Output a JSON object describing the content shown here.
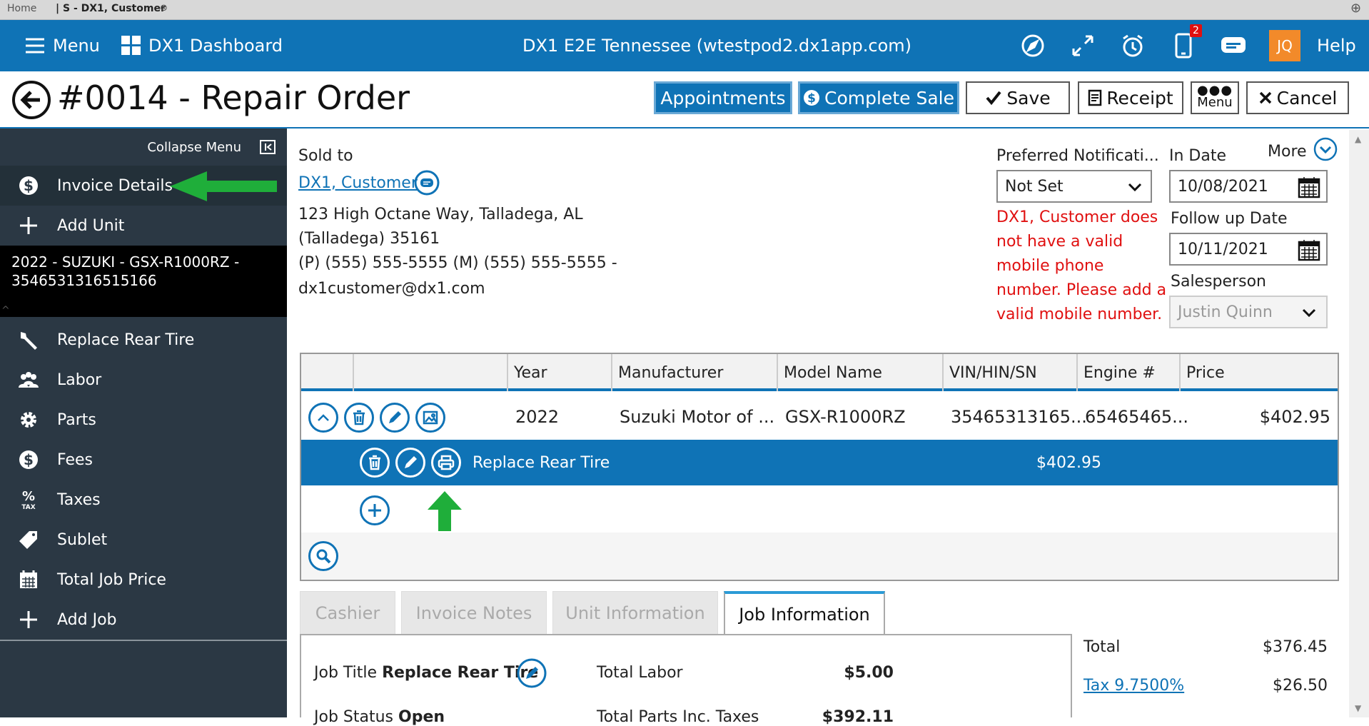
{
  "browser": {
    "home_tab": "Home",
    "active_tab": "| S - DX1, Customer",
    "close_glyph": "⊗",
    "new_tab_glyph": "⊕"
  },
  "topbar": {
    "menu_label": "Menu",
    "dashboard_label": "DX1 Dashboard",
    "site_title": "DX1 E2E Tennessee (wtestpod2.dx1app.com)",
    "phone_badge": "2",
    "avatar_initials": "JQ",
    "help_label": "Help"
  },
  "title": {
    "page_title": "#0014 - Repair Order",
    "appointments_label": "Appointments",
    "complete_sale_label": "Complete Sale",
    "save_label": "Save",
    "receipt_label": "Receipt",
    "menu_label": "Menu",
    "cancel_label": "Cancel"
  },
  "sidebar": {
    "collapse_label": "Collapse Menu",
    "invoice_details": "Invoice Details",
    "add_unit": "Add Unit",
    "unit_line1": "2022 - SUZUKI - GSX-R1000RZ -",
    "unit_line2": "3546531316515166",
    "items": [
      "Replace Rear Tire",
      "Labor",
      "Parts",
      "Fees",
      "Taxes",
      "Sublet",
      "Total Job Price",
      "Add Job"
    ]
  },
  "customer": {
    "sold_to_label": "Sold to",
    "name": "DX1, Customer",
    "address1": "123 High Octane Way, Talladega, AL",
    "address2": "(Talladega) 35161",
    "phones": "(P) (555) 555-5555 (M) (555) 555-5555 -",
    "email": "dx1customer@dx1.com"
  },
  "notification": {
    "label": "Preferred Notificati...",
    "value": "Not Set",
    "warning": [
      "DX1, Customer does",
      "not have a valid",
      "mobile phone",
      "number. Please add a",
      "valid mobile number."
    ]
  },
  "dates": {
    "more_label": "More",
    "in_date_label": "In Date",
    "in_date": "10/08/2021",
    "followup_label": "Follow up Date",
    "followup_date": "10/11/2021",
    "salesperson_label": "Salesperson",
    "salesperson": "Justin Quinn"
  },
  "grid": {
    "headers": [
      "Year",
      "Manufacturer",
      "Model Name",
      "VIN/HIN/SN",
      "Engine #",
      "Price"
    ],
    "unit_row": {
      "year": "2022",
      "manufacturer": "Suzuki Motor of ...",
      "model": "GSX-R1000RZ",
      "vin": "35465313165...",
      "engine": "65465465...",
      "price": "$402.95"
    },
    "job_row": {
      "title": "Replace Rear Tire",
      "price": "$402.95"
    }
  },
  "tabs": [
    "Cashier",
    "Invoice Notes",
    "Unit Information",
    "Job Information"
  ],
  "job_info": {
    "job_title_label": "Job Title",
    "job_title": "Replace Rear Tire",
    "job_status_label": "Job Status",
    "job_status": "Open",
    "total_labor_label": "Total Labor",
    "total_labor": "$5.00",
    "total_parts_label": "Total Parts Inc. Taxes",
    "total_parts": "$392.11"
  },
  "totals": {
    "total_label": "Total",
    "total": "$376.45",
    "tax_label": "Tax 9.7500%",
    "tax": "$26.50"
  },
  "colors": {
    "brand_blue": "#0f73b6",
    "sidebar": "#2b3844",
    "warning_red": "#e01010",
    "arrow_green": "#1fae3a",
    "avatar_orange": "#f28a2a"
  }
}
